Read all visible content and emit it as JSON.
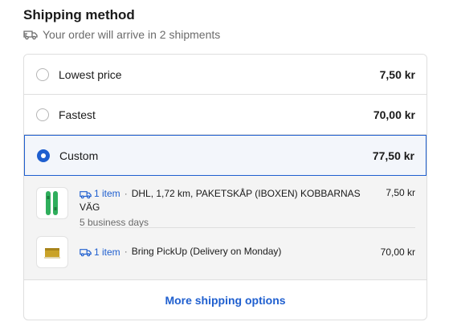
{
  "header": {
    "title": "Shipping method",
    "subtitle": "Your order will arrive in 2 shipments",
    "subtitle_icon": "truck-icon"
  },
  "options": [
    {
      "label": "Lowest price",
      "price": "7,50 kr",
      "selected": false
    },
    {
      "label": "Fastest",
      "price": "70,00 kr",
      "selected": false
    },
    {
      "label": "Custom",
      "price": "77,50 kr",
      "selected": true
    }
  ],
  "shipments": [
    {
      "items": "1 item",
      "description": "DHL, 1,72 km, PAKETSKÅP (IBOXEN) KOBBARNAS VÄG",
      "eta": "5 business days",
      "price": "7,50 kr",
      "thumbnail": "green-snowboard-thumbnail"
    },
    {
      "items": "1 item",
      "description": "Bring PickUp (Delivery on Monday)",
      "price": "70,00 kr",
      "thumbnail": "yellow-box-thumbnail"
    }
  ],
  "more_options_label": "More shipping options",
  "colors": {
    "accent": "#1f5fcf",
    "muted": "#6b6b6b",
    "border": "#dedede",
    "panel": "#f4f4f4"
  }
}
